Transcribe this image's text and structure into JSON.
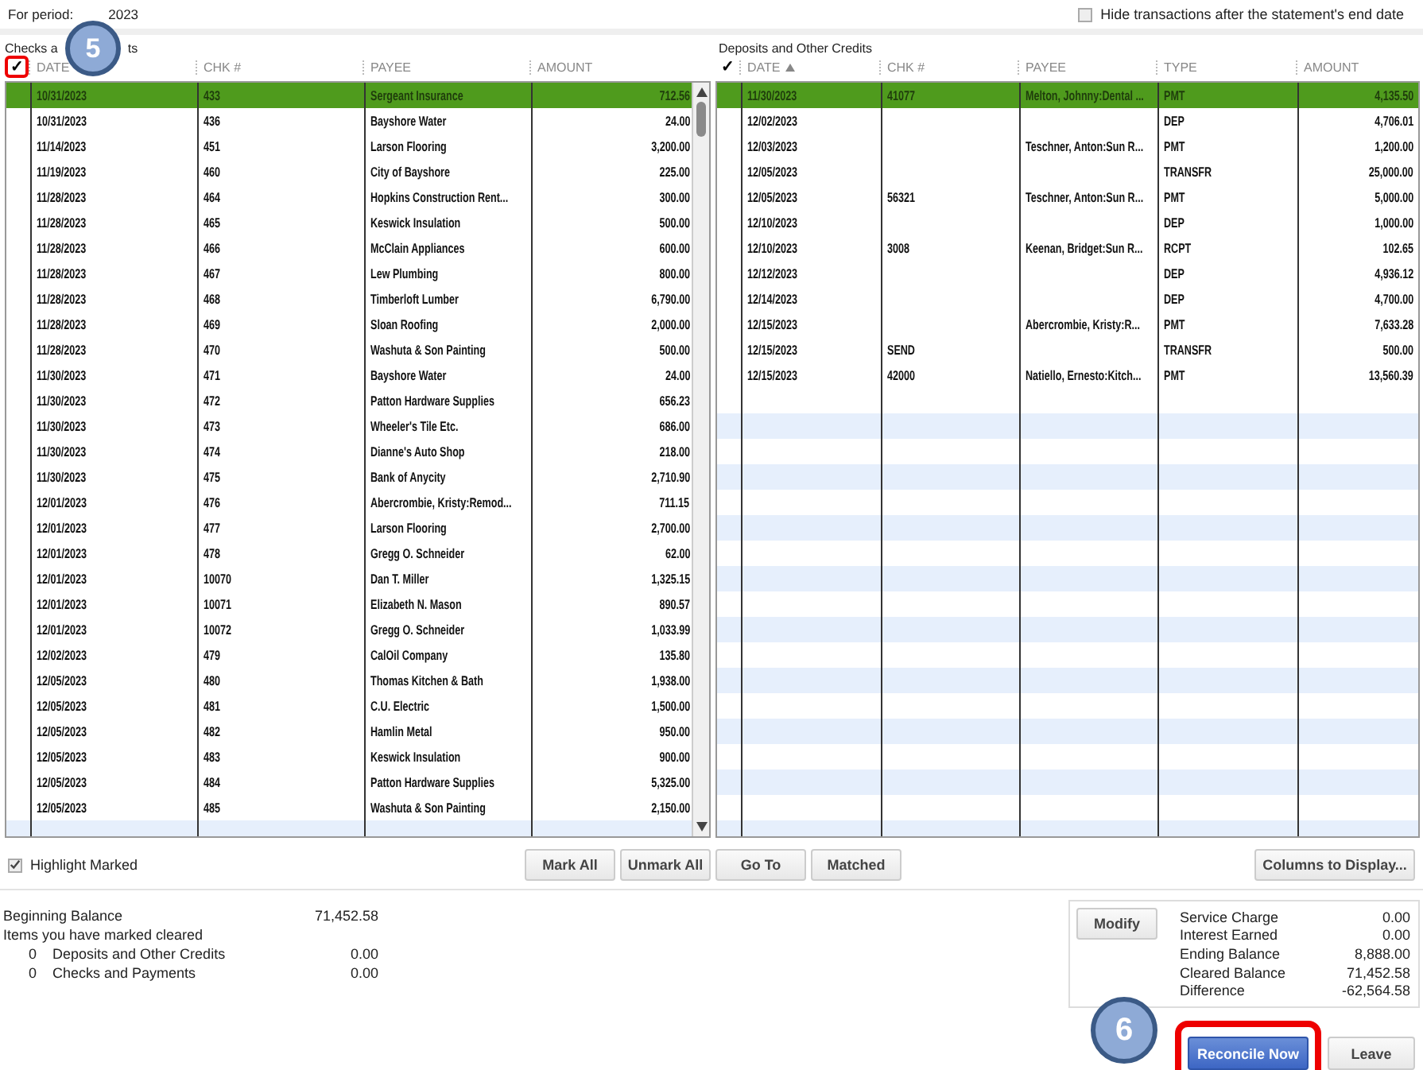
{
  "period": {
    "label": "For period:",
    "value_visible": "2023"
  },
  "hide_after_end_date": {
    "label": "Hide transactions after the statement's end date",
    "checked": false
  },
  "checks_panel": {
    "title_parts": [
      "Checks a",
      "ts"
    ],
    "mark_header": "✓",
    "mark_callout": true,
    "columns": [
      {
        "label": "DATE",
        "sorted": false
      },
      {
        "label": "CHK #",
        "sorted": false
      },
      {
        "label": "PAYEE",
        "sorted": false
      },
      {
        "label": "AMOUNT",
        "sorted": false
      }
    ],
    "rows": [
      {
        "date": "10/31/2023",
        "chk": "433",
        "payee": "Sergeant Insurance",
        "amount": "712.56",
        "selected": true
      },
      {
        "date": "10/31/2023",
        "chk": "436",
        "payee": "Bayshore Water",
        "amount": "24.00",
        "selected": false
      },
      {
        "date": "11/14/2023",
        "chk": "451",
        "payee": "Larson Flooring",
        "amount": "3,200.00",
        "selected": false
      },
      {
        "date": "11/19/2023",
        "chk": "460",
        "payee": "City of Bayshore",
        "amount": "225.00",
        "selected": false
      },
      {
        "date": "11/28/2023",
        "chk": "464",
        "payee": "Hopkins Construction Rent...",
        "amount": "300.00",
        "selected": false
      },
      {
        "date": "11/28/2023",
        "chk": "465",
        "payee": "Keswick Insulation",
        "amount": "500.00",
        "selected": false
      },
      {
        "date": "11/28/2023",
        "chk": "466",
        "payee": "McClain Appliances",
        "amount": "600.00",
        "selected": false
      },
      {
        "date": "11/28/2023",
        "chk": "467",
        "payee": "Lew Plumbing",
        "amount": "800.00",
        "selected": false
      },
      {
        "date": "11/28/2023",
        "chk": "468",
        "payee": "Timberloft Lumber",
        "amount": "6,790.00",
        "selected": false
      },
      {
        "date": "11/28/2023",
        "chk": "469",
        "payee": "Sloan Roofing",
        "amount": "2,000.00",
        "selected": false
      },
      {
        "date": "11/28/2023",
        "chk": "470",
        "payee": "Washuta & Son Painting",
        "amount": "500.00",
        "selected": false
      },
      {
        "date": "11/30/2023",
        "chk": "471",
        "payee": "Bayshore Water",
        "amount": "24.00",
        "selected": false
      },
      {
        "date": "11/30/2023",
        "chk": "472",
        "payee": "Patton Hardware Supplies",
        "amount": "656.23",
        "selected": false
      },
      {
        "date": "11/30/2023",
        "chk": "473",
        "payee": "Wheeler's Tile Etc.",
        "amount": "686.00",
        "selected": false
      },
      {
        "date": "11/30/2023",
        "chk": "474",
        "payee": "Dianne's Auto Shop",
        "amount": "218.00",
        "selected": false
      },
      {
        "date": "11/30/2023",
        "chk": "475",
        "payee": "Bank of Anycity",
        "amount": "2,710.90",
        "selected": false
      },
      {
        "date": "12/01/2023",
        "chk": "476",
        "payee": "Abercrombie, Kristy:Remod...",
        "amount": "711.15",
        "selected": false
      },
      {
        "date": "12/01/2023",
        "chk": "477",
        "payee": "Larson Flooring",
        "amount": "2,700.00",
        "selected": false
      },
      {
        "date": "12/01/2023",
        "chk": "478",
        "payee": "Gregg O. Schneider",
        "amount": "62.00",
        "selected": false
      },
      {
        "date": "12/01/2023",
        "chk": "10070",
        "payee": "Dan T. Miller",
        "amount": "1,325.15",
        "selected": false
      },
      {
        "date": "12/01/2023",
        "chk": "10071",
        "payee": "Elizabeth N. Mason",
        "amount": "890.57",
        "selected": false
      },
      {
        "date": "12/01/2023",
        "chk": "10072",
        "payee": "Gregg O. Schneider",
        "amount": "1,033.99",
        "selected": false
      },
      {
        "date": "12/02/2023",
        "chk": "479",
        "payee": "CalOil Company",
        "amount": "135.80",
        "selected": false
      },
      {
        "date": "12/05/2023",
        "chk": "480",
        "payee": "Thomas Kitchen & Bath",
        "amount": "1,938.00",
        "selected": false
      },
      {
        "date": "12/05/2023",
        "chk": "481",
        "payee": "C.U. Electric",
        "amount": "1,500.00",
        "selected": false
      },
      {
        "date": "12/05/2023",
        "chk": "482",
        "payee": "Hamlin Metal",
        "amount": "950.00",
        "selected": false
      },
      {
        "date": "12/05/2023",
        "chk": "483",
        "payee": "Keswick Insulation",
        "amount": "900.00",
        "selected": false
      },
      {
        "date": "12/05/2023",
        "chk": "484",
        "payee": "Patton Hardware Supplies",
        "amount": "5,325.00",
        "selected": false
      },
      {
        "date": "12/05/2023",
        "chk": "485",
        "payee": "Washuta & Son Painting",
        "amount": "2,150.00",
        "selected": false
      }
    ]
  },
  "deposits_panel": {
    "title": "Deposits and Other Credits",
    "mark_header": "✓",
    "mark_callout": false,
    "columns": [
      {
        "label": "DATE",
        "sorted": true
      },
      {
        "label": "CHK #",
        "sorted": false
      },
      {
        "label": "PAYEE",
        "sorted": false
      },
      {
        "label": "TYPE",
        "sorted": false
      },
      {
        "label": "AMOUNT",
        "sorted": false
      }
    ],
    "rows": [
      {
        "date": "11/30/2023",
        "chk": "41077",
        "payee": "Melton, Johnny:Dental ...",
        "type": "PMT",
        "amount": "4,135.50",
        "selected": true
      },
      {
        "date": "12/02/2023",
        "chk": "",
        "payee": "",
        "type": "DEP",
        "amount": "4,706.01",
        "selected": false
      },
      {
        "date": "12/03/2023",
        "chk": "",
        "payee": "Teschner, Anton:Sun R...",
        "type": "PMT",
        "amount": "1,200.00",
        "selected": false
      },
      {
        "date": "12/05/2023",
        "chk": "",
        "payee": "",
        "type": "TRANSFR",
        "amount": "25,000.00",
        "selected": false
      },
      {
        "date": "12/05/2023",
        "chk": "56321",
        "payee": "Teschner, Anton:Sun R...",
        "type": "PMT",
        "amount": "5,000.00",
        "selected": false
      },
      {
        "date": "12/10/2023",
        "chk": "",
        "payee": "",
        "type": "DEP",
        "amount": "1,000.00",
        "selected": false
      },
      {
        "date": "12/10/2023",
        "chk": "3008",
        "payee": "Keenan, Bridget:Sun R...",
        "type": "RCPT",
        "amount": "102.65",
        "selected": false
      },
      {
        "date": "12/12/2023",
        "chk": "",
        "payee": "",
        "type": "DEP",
        "amount": "4,936.12",
        "selected": false
      },
      {
        "date": "12/14/2023",
        "chk": "",
        "payee": "",
        "type": "DEP",
        "amount": "4,700.00",
        "selected": false
      },
      {
        "date": "12/15/2023",
        "chk": "",
        "payee": "Abercrombie, Kristy:R...",
        "type": "PMT",
        "amount": "7,633.28",
        "selected": false
      },
      {
        "date": "12/15/2023",
        "chk": "SEND",
        "payee": "",
        "type": "TRANSFR",
        "amount": "500.00",
        "selected": false
      },
      {
        "date": "12/15/2023",
        "chk": "42000",
        "payee": "Natiello, Ernesto:Kitch...",
        "type": "PMT",
        "amount": "13,560.39",
        "selected": false
      }
    ]
  },
  "highlight_marked": {
    "label": "Highlight Marked",
    "checked": true
  },
  "buttons": [
    "Mark All",
    "Unmark All",
    "Go To",
    "Matched"
  ],
  "columns_button": "Columns to Display...",
  "summary": {
    "beginning_label": "Beginning Balance",
    "beginning_value": "71,452.58",
    "items_label": "Items you have marked cleared",
    "lines": [
      {
        "count": "0",
        "label": "Deposits and Other Credits",
        "value": "0.00"
      },
      {
        "count": "0",
        "label": "Checks and Payments",
        "value": "0.00"
      }
    ]
  },
  "totals": {
    "modify_button": "Modify",
    "lines": [
      {
        "label": "Service Charge",
        "value": "0.00"
      },
      {
        "label": "Interest Earned",
        "value": "0.00"
      },
      {
        "label": "Ending Balance",
        "value": "8,888.00"
      },
      {
        "label": "Cleared Balance",
        "value": "71,452.58"
      },
      {
        "label": "Difference",
        "value": "-62,564.58"
      }
    ]
  },
  "actions": [
    {
      "label": "Reconcile Now",
      "kind": "primary",
      "callout": true
    },
    {
      "label": "Leave",
      "kind": "normal",
      "callout": false
    }
  ],
  "annotations": [
    "5",
    "6"
  ]
}
